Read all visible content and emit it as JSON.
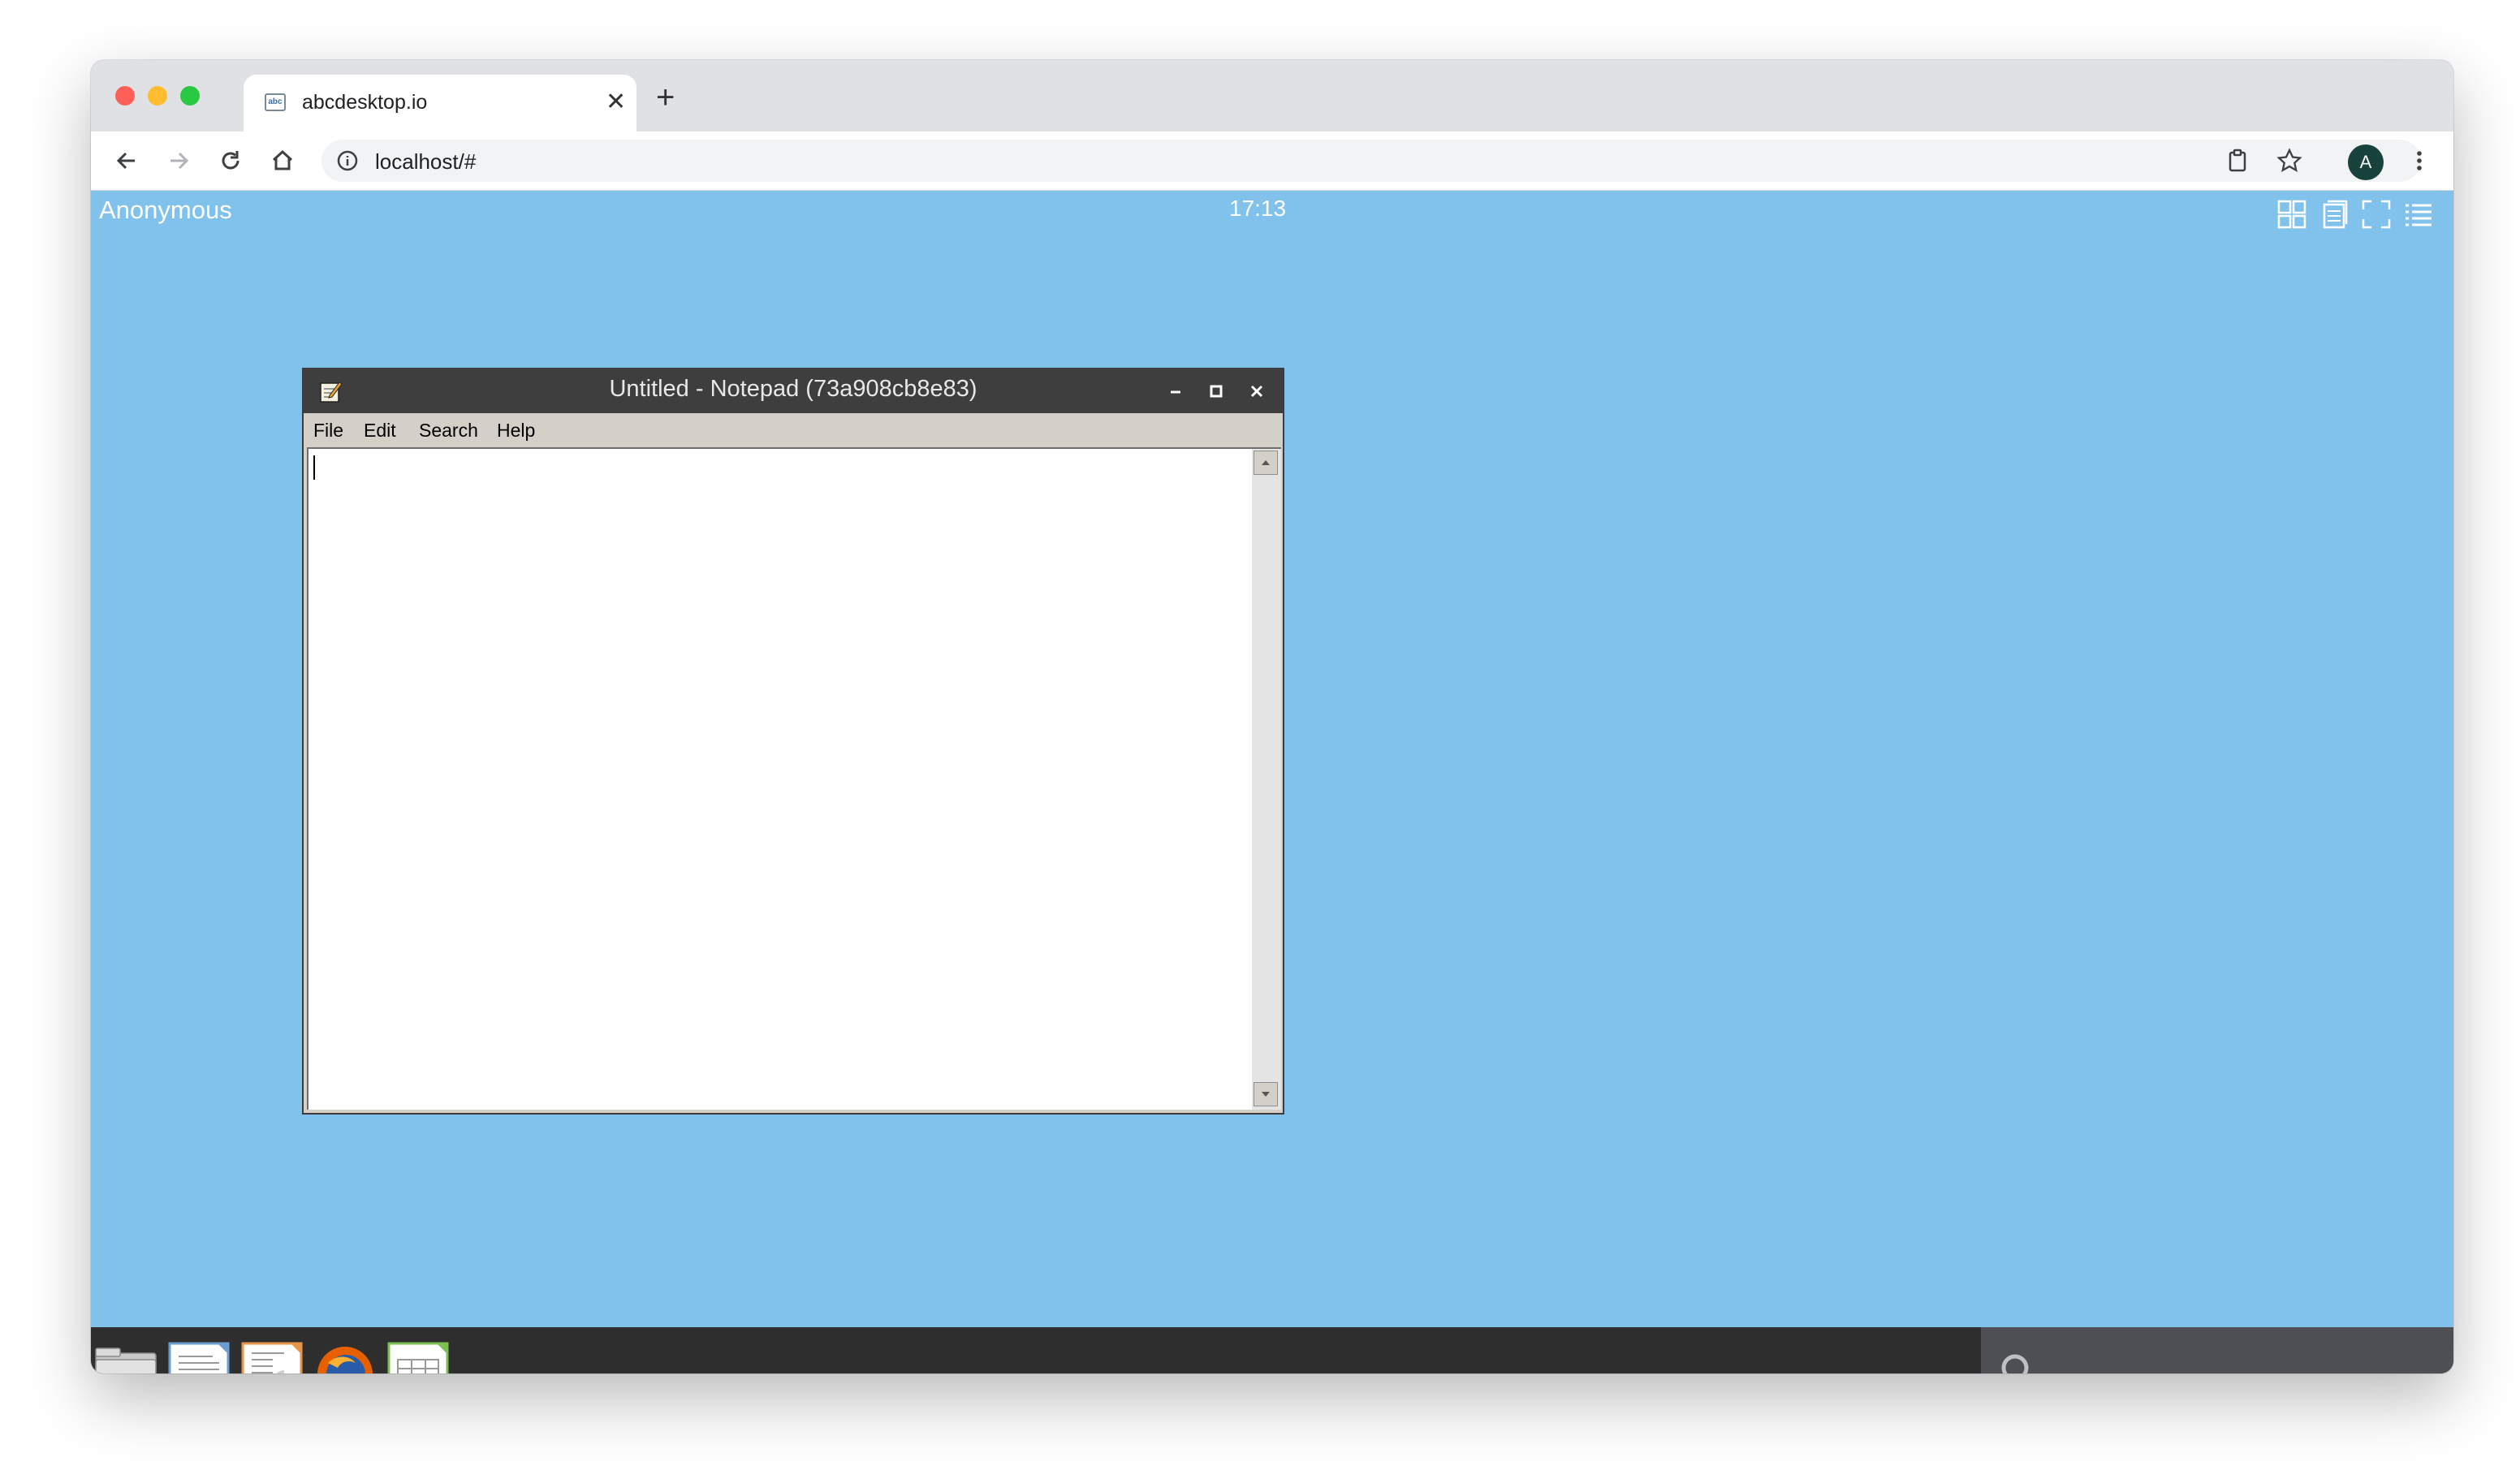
{
  "browser": {
    "tab": {
      "title": "abcdesktop.io",
      "favicon": "abc"
    },
    "address": {
      "url": "localhost/#"
    },
    "profile_initial": "A"
  },
  "desktop": {
    "user_name": "Anonymous",
    "clock": "17:13"
  },
  "notepad": {
    "title": "Untitled - Notepad (73a908cb8e83)",
    "menu": {
      "file": "File",
      "edit": "Edit",
      "search": "Search",
      "help": "Help"
    },
    "content": ""
  },
  "dock": {
    "items": [
      "home-folder-icon",
      "text-document-icon",
      "presentation-icon",
      "firefox-icon",
      "spreadsheet-icon"
    ]
  },
  "colors": {
    "desktop_bg": "#81c2ec",
    "taskbar_bg": "#2e2e2e",
    "search_panel_bg": "#4e4f55",
    "window_titlebar": "#3e3e3e"
  }
}
